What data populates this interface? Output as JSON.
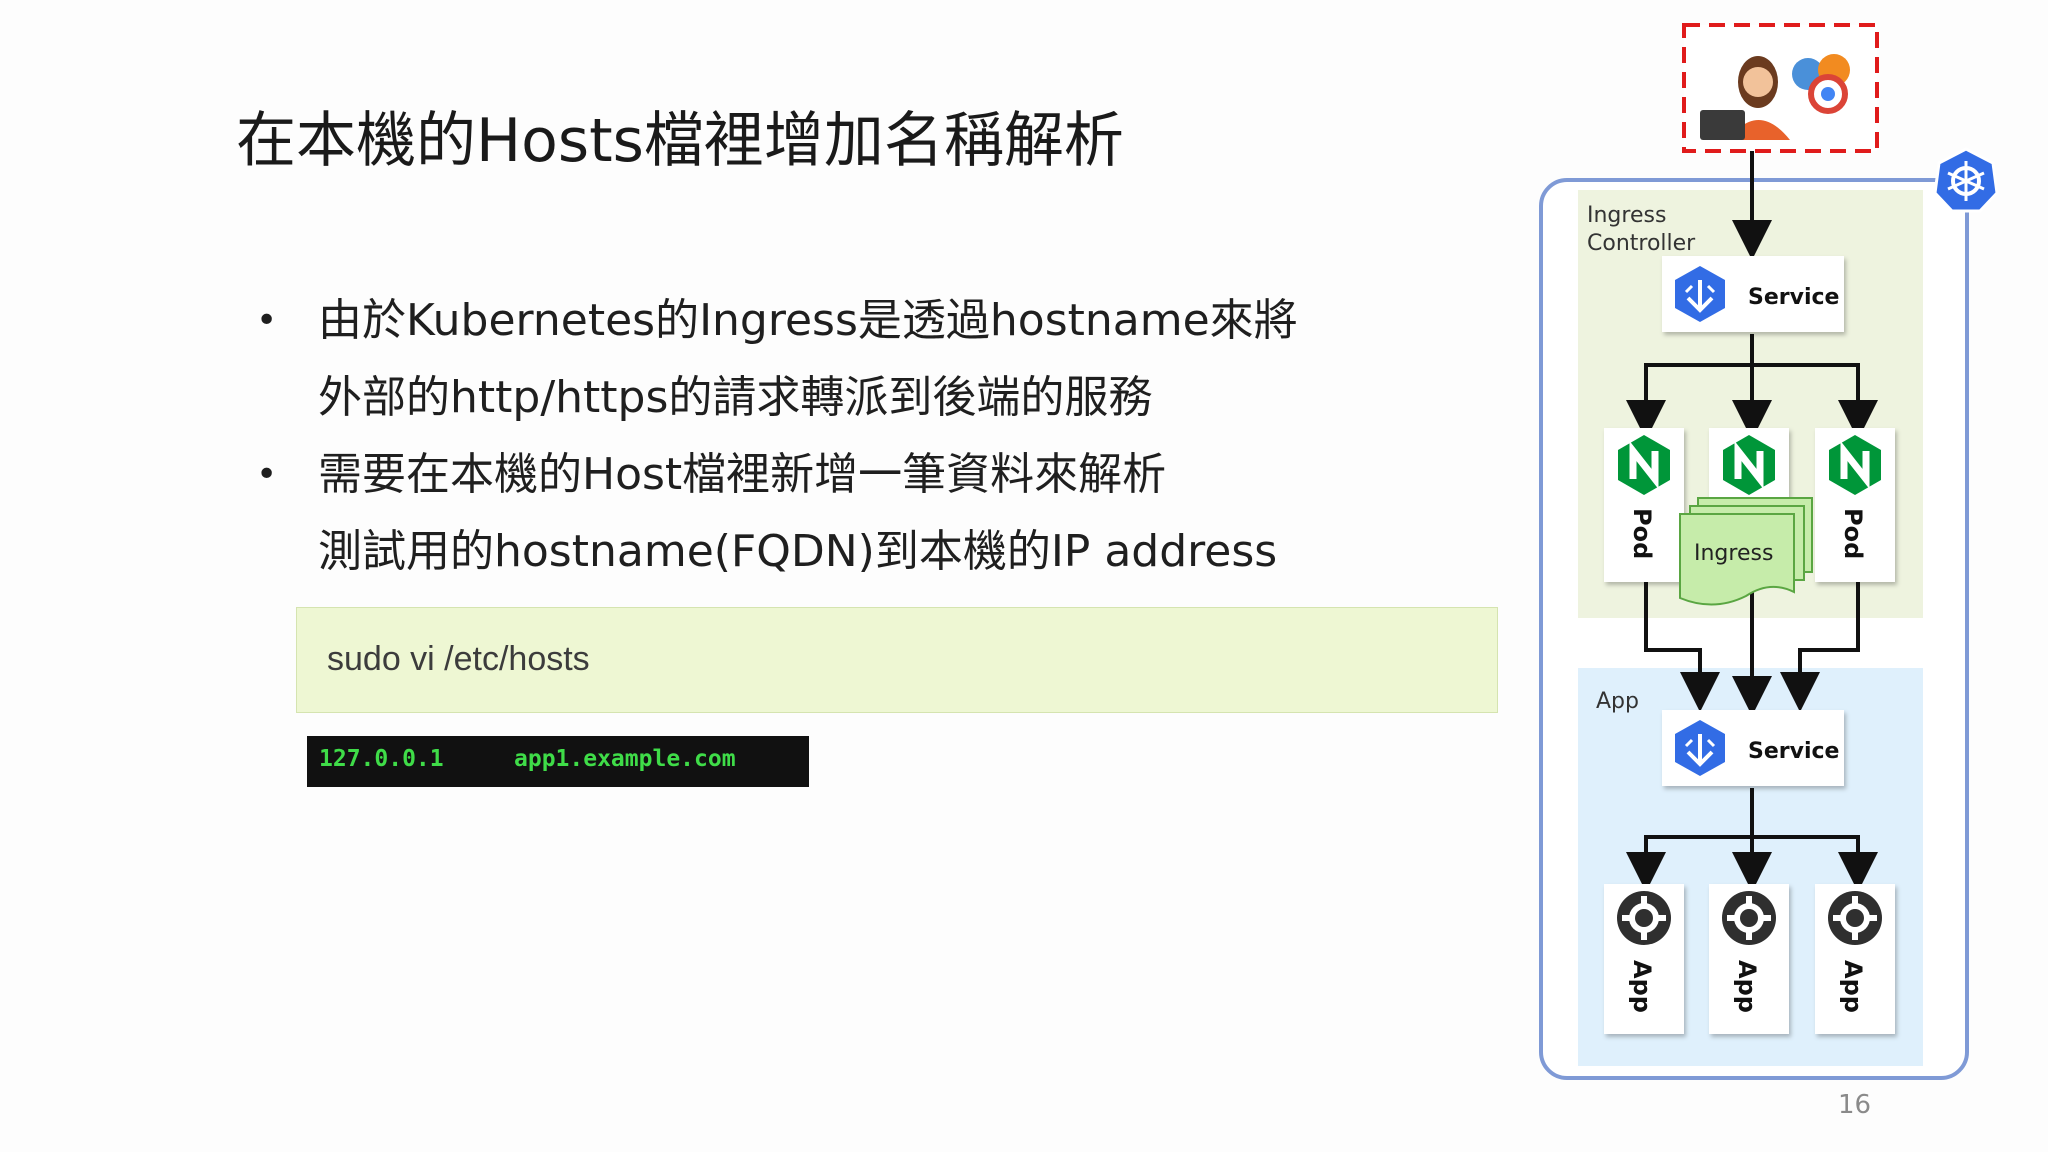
{
  "slide": {
    "title": "在本機的Hosts檔裡增加名稱解析",
    "bullets": [
      {
        "lines": [
          "由於Kubernetes的Ingress是透過hostname來將",
          "外部的http/https的請求轉派到後端的服務"
        ]
      },
      {
        "lines": [
          "需要在本機的Host檔裡新增一筆資料來解析",
          "測試用的hostname(FQDN)到本機的IP address"
        ]
      }
    ],
    "bullet_symbol": "•",
    "code": "sudo vi /etc/hosts",
    "terminal": {
      "ip": "127.0.0.1",
      "host": "app1.example.com"
    },
    "page_number": "16"
  },
  "diagram": {
    "ingress_controller_label_1": "Ingress",
    "ingress_controller_label_2": "Controller",
    "service_label": "Service",
    "pod_label": "Pod",
    "nginx_letter": "N",
    "ingress_resource_label": "Ingress",
    "app_section_label": "App",
    "app_pod_label": "App",
    "colors": {
      "k8s_blue": "#326ce5",
      "cluster_border": "#7f9ad6",
      "ingress_bg": "#eef3df",
      "app_bg": "#dff0fc",
      "nginx_green": "#009639",
      "client_border": "#e01b1b",
      "ingress_doc": "#c6ecaa"
    },
    "icons": [
      "user-laptop-icon",
      "browser-icons",
      "kubernetes-logo-icon",
      "service-icon",
      "nginx-icon",
      "gear-icon"
    ]
  }
}
